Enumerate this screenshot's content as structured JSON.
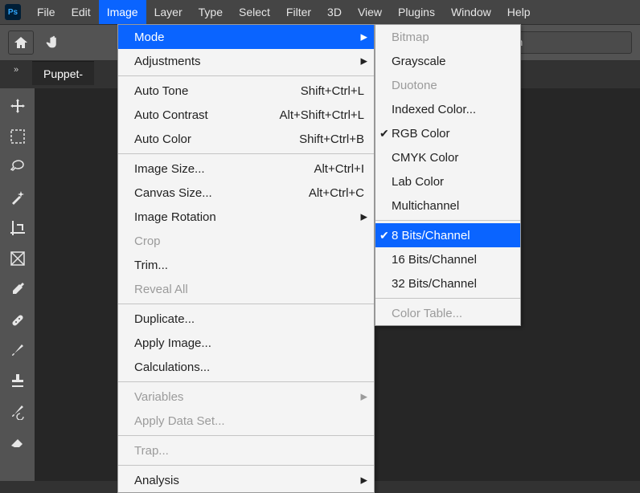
{
  "app_logo": "Ps",
  "menubar": {
    "items": [
      "File",
      "Edit",
      "Image",
      "Layer",
      "Type",
      "Select",
      "Filter",
      "3D",
      "View",
      "Plugins",
      "Window",
      "Help"
    ],
    "active_index": 2
  },
  "options_bar": {
    "right_field": "n"
  },
  "document_tab": "Puppet-",
  "image_menu": {
    "groups": [
      [
        {
          "label": "Mode",
          "arrow": true,
          "highlight": true
        },
        {
          "label": "Adjustments",
          "arrow": true
        }
      ],
      [
        {
          "label": "Auto Tone",
          "shortcut": "Shift+Ctrl+L"
        },
        {
          "label": "Auto Contrast",
          "shortcut": "Alt+Shift+Ctrl+L"
        },
        {
          "label": "Auto Color",
          "shortcut": "Shift+Ctrl+B"
        }
      ],
      [
        {
          "label": "Image Size...",
          "shortcut": "Alt+Ctrl+I"
        },
        {
          "label": "Canvas Size...",
          "shortcut": "Alt+Ctrl+C"
        },
        {
          "label": "Image Rotation",
          "arrow": true
        },
        {
          "label": "Crop",
          "disabled": true
        },
        {
          "label": "Trim..."
        },
        {
          "label": "Reveal All",
          "disabled": true
        }
      ],
      [
        {
          "label": "Duplicate..."
        },
        {
          "label": "Apply Image..."
        },
        {
          "label": "Calculations..."
        }
      ],
      [
        {
          "label": "Variables",
          "arrow": true,
          "disabled": true
        },
        {
          "label": "Apply Data Set...",
          "disabled": true
        }
      ],
      [
        {
          "label": "Trap...",
          "disabled": true
        }
      ],
      [
        {
          "label": "Analysis",
          "arrow": true
        }
      ]
    ]
  },
  "mode_menu": {
    "groups": [
      [
        {
          "label": "Bitmap",
          "disabled": true
        },
        {
          "label": "Grayscale"
        },
        {
          "label": "Duotone",
          "disabled": true
        },
        {
          "label": "Indexed Color..."
        },
        {
          "label": "RGB Color",
          "checked": true
        },
        {
          "label": "CMYK Color"
        },
        {
          "label": "Lab Color"
        },
        {
          "label": "Multichannel"
        }
      ],
      [
        {
          "label": "8 Bits/Channel",
          "checked": true,
          "highlight": true
        },
        {
          "label": "16 Bits/Channel"
        },
        {
          "label": "32 Bits/Channel"
        }
      ],
      [
        {
          "label": "Color Table...",
          "disabled": true
        }
      ]
    ]
  },
  "tools": [
    "move",
    "marquee",
    "lasso",
    "wand",
    "crop",
    "frame",
    "eyedropper",
    "healing",
    "brush",
    "stamp",
    "history-brush",
    "eraser"
  ]
}
